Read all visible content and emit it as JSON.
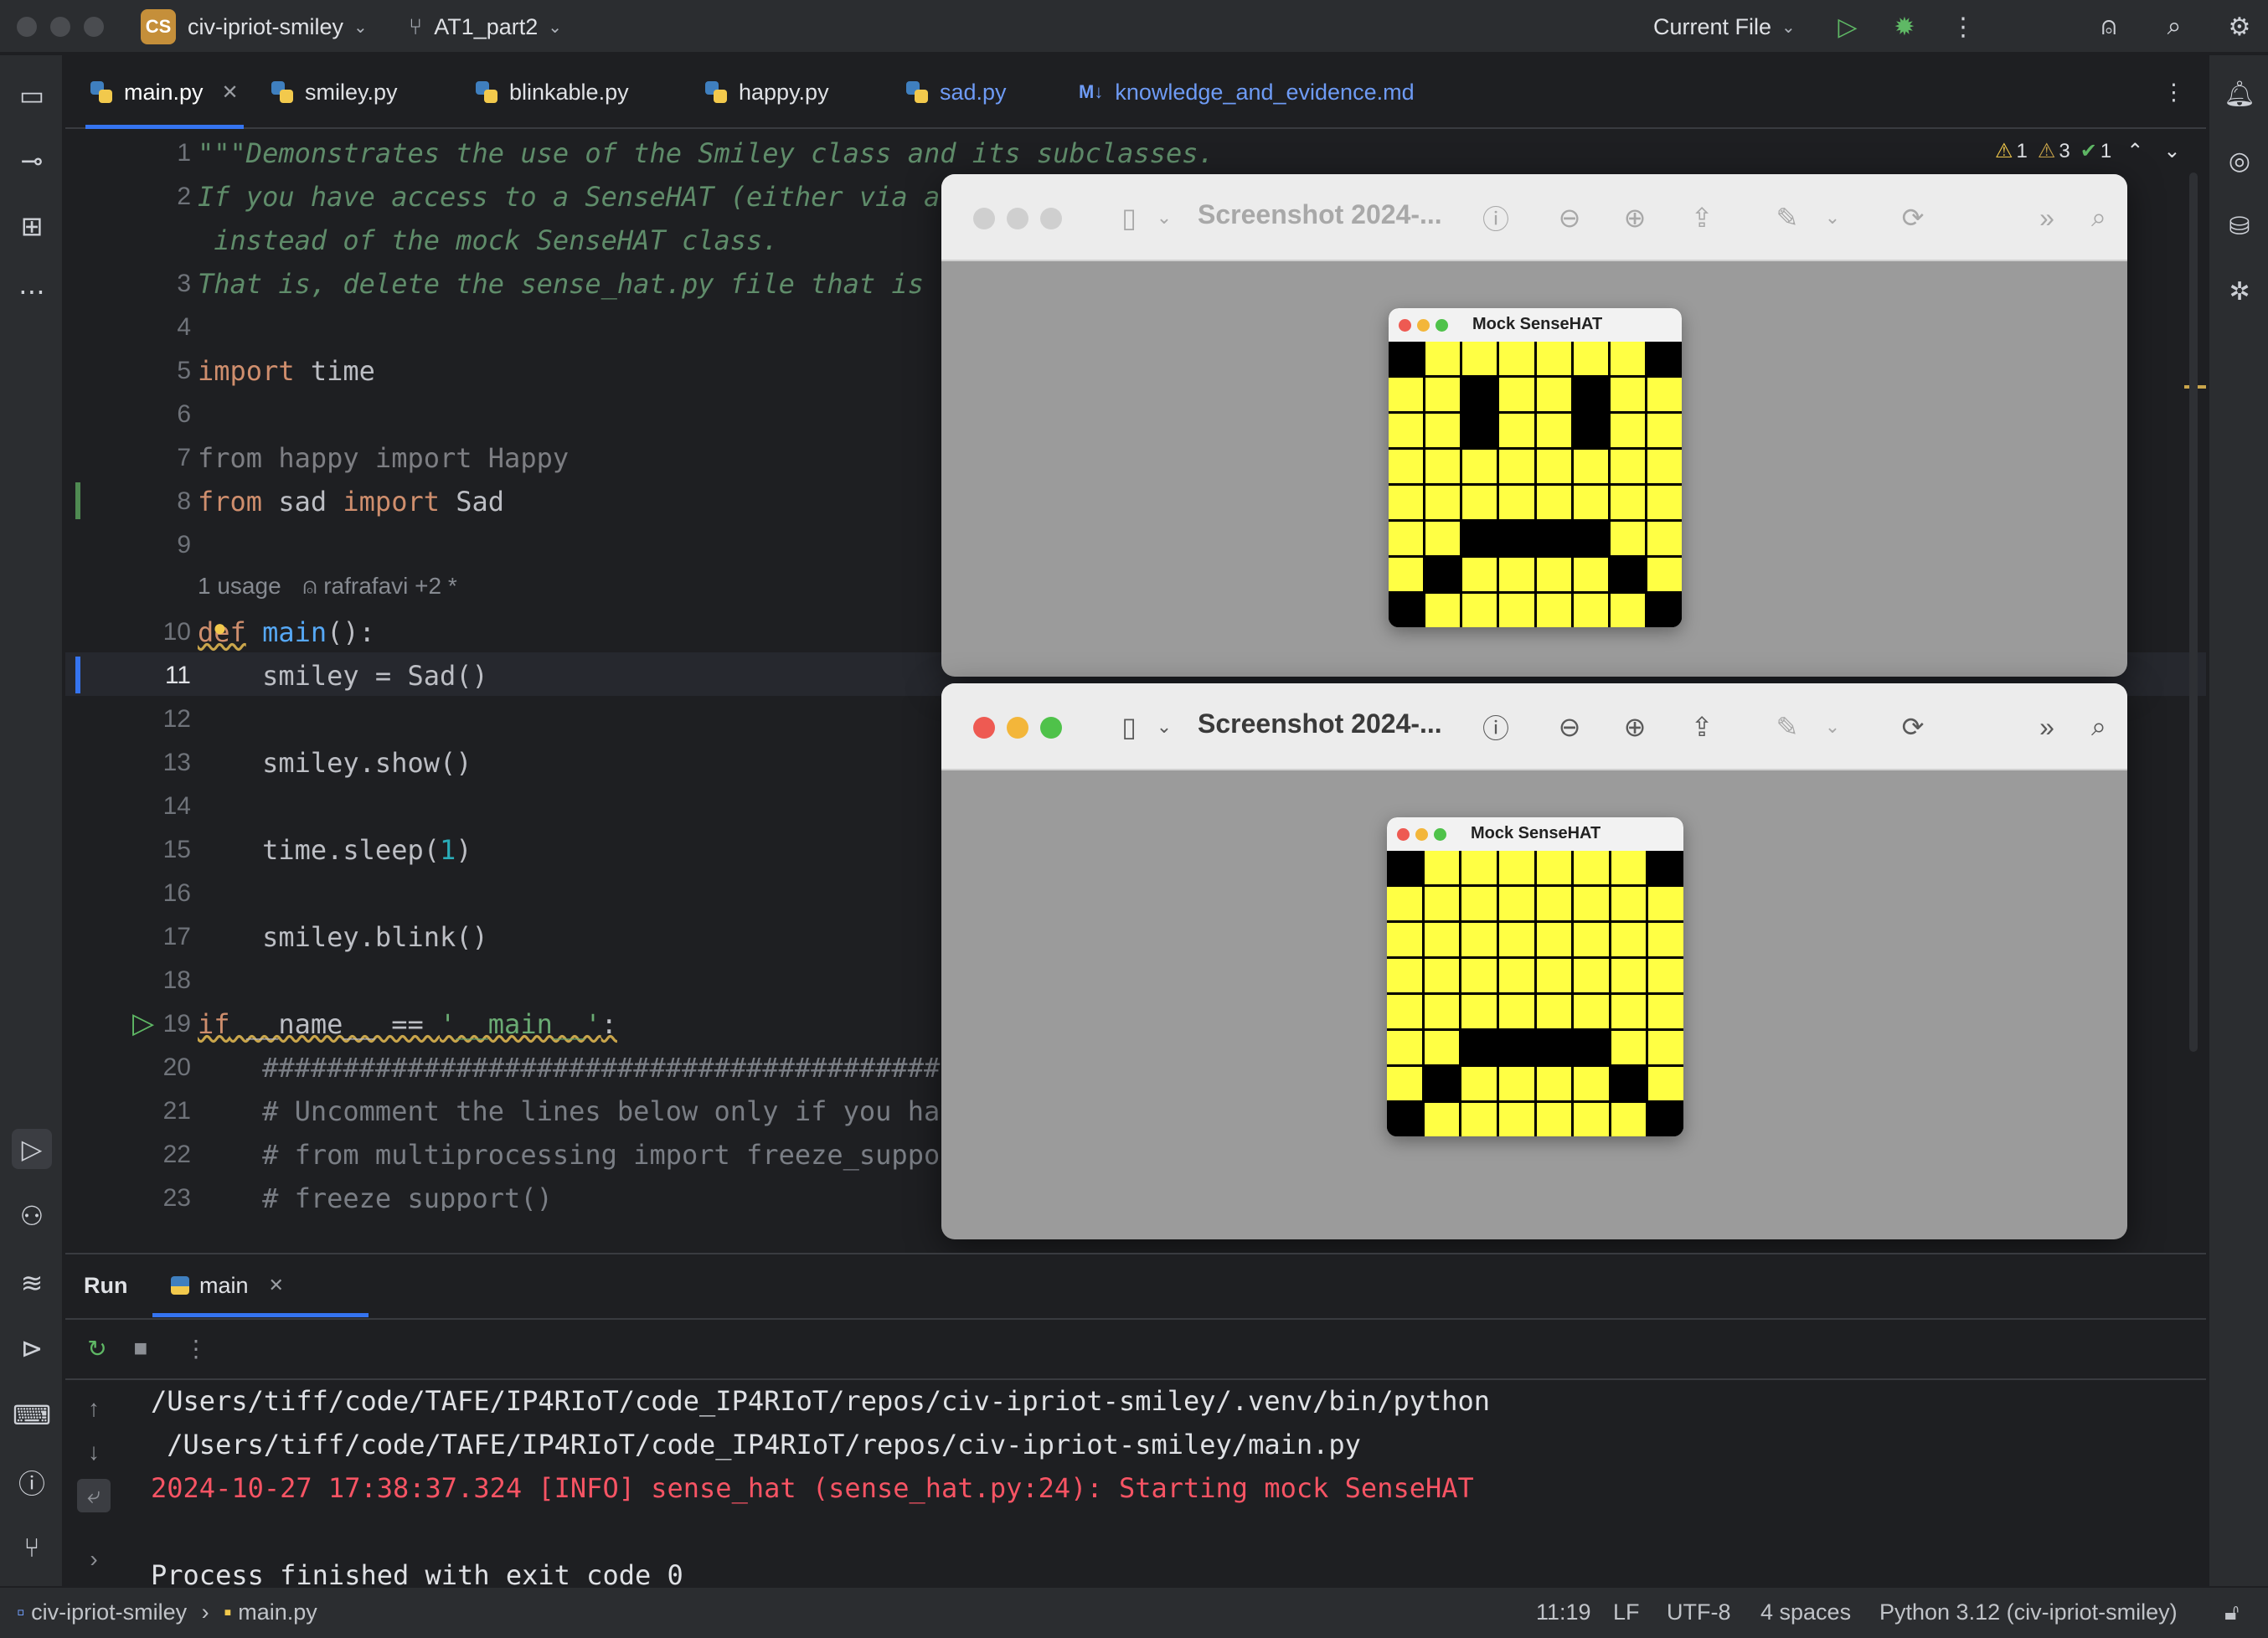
{
  "titlebar": {
    "project_badge": "CS",
    "project_name": "civ-ipriot-smiley",
    "branch": "AT1_part2",
    "run_config": "Current File"
  },
  "tabs": [
    {
      "label": "main.py",
      "active": true
    },
    {
      "label": "smiley.py"
    },
    {
      "label": "blinkable.py"
    },
    {
      "label": "happy.py"
    },
    {
      "label": "sad.py"
    },
    {
      "label": "knowledge_and_evidence.md",
      "icon": "M↓"
    }
  ],
  "inspections": {
    "warnings": "1",
    "weak_warnings": "3",
    "ok": "1"
  },
  "editor": {
    "lines": [
      {
        "n": "1",
        "text": "\"\"\"Demonstrates the use of the Smiley class and its subclasses."
      },
      {
        "n": "2",
        "text": "If you have access to a SenseHAT (either via a"
      },
      {
        "n": "",
        "text": " instead of the mock SenseHAT class."
      },
      {
        "n": "3",
        "text": "That is, delete the sense_hat.py file that is"
      },
      {
        "n": "4",
        "text": ""
      },
      {
        "n": "5",
        "kw": "import",
        "rest": " time"
      },
      {
        "n": "6",
        "text": ""
      },
      {
        "n": "7",
        "text": "from happy import Happy"
      },
      {
        "n": "8",
        "kw": "from",
        "mid": " sad ",
        "kw2": "import",
        "rest": " Sad"
      },
      {
        "n": "9",
        "text": ""
      },
      {
        "n": "10",
        "kw": "def",
        "fn": "main",
        "rest": "():"
      },
      {
        "n": "11",
        "text": "    smiley = Sad()"
      },
      {
        "n": "12",
        "text": ""
      },
      {
        "n": "13",
        "text": "    smiley.show()"
      },
      {
        "n": "14",
        "text": ""
      },
      {
        "n": "15",
        "pre": "    time.sleep(",
        "num": "1",
        "post": ")"
      },
      {
        "n": "16",
        "text": ""
      },
      {
        "n": "17",
        "text": "    smiley.blink()"
      },
      {
        "n": "18",
        "text": ""
      },
      {
        "n": "19",
        "kw": "if",
        "mid": " __name__ == ",
        "str": "'__main__'",
        "rest": ":"
      },
      {
        "n": "20",
        "text": "    ##########################################"
      },
      {
        "n": "21",
        "text": "    # Uncomment the lines below only if you hav"
      },
      {
        "n": "22",
        "text": "    # from multiprocessing import freeze_suppo"
      },
      {
        "n": "23",
        "text": "    # freeze_support()"
      }
    ],
    "hint_usages": "1 usage",
    "hint_author": "rafrafavi +2 *"
  },
  "previews": [
    {
      "title": "Screenshot 2024-...",
      "hat_title": "Mock SenseHAT",
      "active": false
    },
    {
      "title": "Screenshot 2024-...",
      "hat_title": "Mock SenseHAT",
      "active": true
    }
  ],
  "sense_hat_grid_top": [
    [
      0,
      1,
      1,
      1,
      1,
      1,
      1,
      0
    ],
    [
      1,
      1,
      0,
      1,
      1,
      0,
      1,
      1
    ],
    [
      1,
      1,
      0,
      1,
      1,
      0,
      1,
      1
    ],
    [
      1,
      1,
      1,
      1,
      1,
      1,
      1,
      1
    ],
    [
      1,
      1,
      1,
      1,
      1,
      1,
      1,
      1
    ],
    [
      1,
      1,
      0,
      0,
      0,
      0,
      1,
      1
    ],
    [
      1,
      0,
      1,
      1,
      1,
      1,
      0,
      1
    ],
    [
      0,
      1,
      1,
      1,
      1,
      1,
      1,
      0
    ]
  ],
  "sense_hat_grid_bottom": [
    [
      0,
      1,
      1,
      1,
      1,
      1,
      1,
      0
    ],
    [
      1,
      1,
      1,
      1,
      1,
      1,
      1,
      1
    ],
    [
      1,
      1,
      1,
      1,
      1,
      1,
      1,
      1
    ],
    [
      1,
      1,
      1,
      1,
      1,
      1,
      1,
      1
    ],
    [
      1,
      1,
      1,
      1,
      1,
      1,
      1,
      1
    ],
    [
      1,
      1,
      0,
      0,
      0,
      0,
      1,
      1
    ],
    [
      1,
      0,
      1,
      1,
      1,
      1,
      0,
      1
    ],
    [
      0,
      1,
      1,
      1,
      1,
      1,
      1,
      0
    ]
  ],
  "run_panel": {
    "title": "Run",
    "tab": "main",
    "console": [
      {
        "text": "/Users/tiff/code/TAFE/IP4RIoT/code_IP4RIoT/repos/civ-ipriot-smiley/.venv/bin/python",
        "err": false
      },
      {
        "text": " /Users/tiff/code/TAFE/IP4RIoT/code_IP4RIoT/repos/civ-ipriot-smiley/main.py",
        "err": false
      },
      {
        "text": "2024-10-27 17:38:37.324 [INFO] sense_hat (sense_hat.py:24): Starting mock SenseHAT",
        "err": true
      },
      {
        "text": "",
        "err": false
      },
      {
        "text": "Process finished with exit code 0",
        "err": false
      }
    ]
  },
  "statusbar": {
    "project": "civ-ipriot-smiley",
    "file": "main.py",
    "position": "11:19",
    "line_sep": "LF",
    "encoding": "UTF-8",
    "indent": "4 spaces",
    "interpreter": "Python 3.12 (civ-ipriot-smiley)"
  },
  "colors": {
    "accent": "#3574f0",
    "led_on": "#ffff44",
    "error_text": "#f75464"
  }
}
